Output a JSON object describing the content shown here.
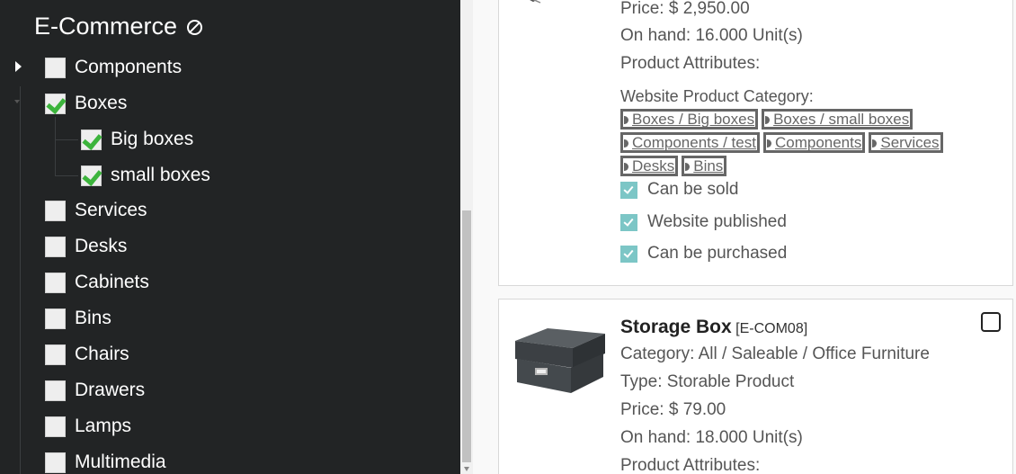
{
  "sidebar": {
    "title": "E-Commerce",
    "categories": [
      {
        "label": "Components",
        "checked": false
      },
      {
        "label": "Boxes",
        "checked": true
      },
      {
        "label": "Big boxes",
        "checked": true
      },
      {
        "label": "small boxes",
        "checked": true
      },
      {
        "label": "Services",
        "checked": false
      },
      {
        "label": "Desks",
        "checked": false
      },
      {
        "label": "Cabinets",
        "checked": false
      },
      {
        "label": "Bins",
        "checked": false
      },
      {
        "label": "Chairs",
        "checked": false
      },
      {
        "label": "Drawers",
        "checked": false
      },
      {
        "label": "Lamps",
        "checked": false
      },
      {
        "label": "Multimedia",
        "checked": false
      }
    ]
  },
  "product1": {
    "price": "Price: $ 2,950.00",
    "on_hand": "On hand: 16.000 Unit(s)",
    "attributes": "Product Attributes:",
    "website_category_label": "Website Product Category:",
    "tags": [
      "Boxes / Big boxes",
      "Boxes / small boxes",
      "Components / test",
      "Components",
      "Services",
      "Desks",
      "Bins"
    ],
    "flags": [
      "Can be sold",
      "Website published",
      "Can be purchased"
    ]
  },
  "product2": {
    "name": "Storage Box",
    "ref": "[E-COM08]",
    "category": "Category: All / Saleable / Office Furniture",
    "type": "Type: Storable Product",
    "price": "Price: $ 79.00",
    "on_hand": "On hand: 18.000 Unit(s)",
    "attributes": "Product Attributes:"
  },
  "colors": {
    "sidebar_bg": "#222425",
    "check_green": "#3cb43c",
    "flag_teal": "#7cc6c6"
  }
}
